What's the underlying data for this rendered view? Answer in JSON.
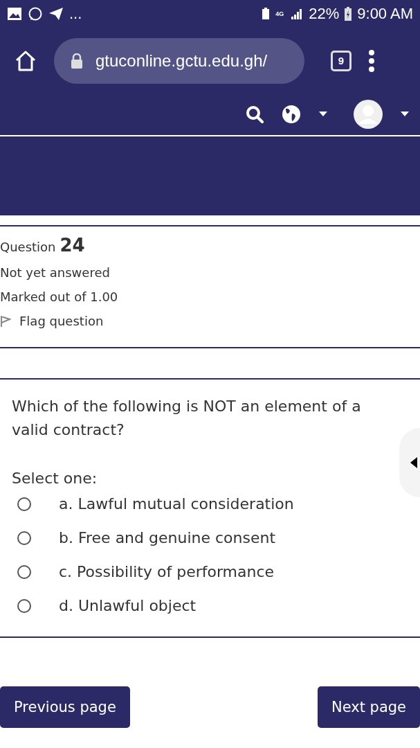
{
  "status_bar": {
    "more": "...",
    "network": "4G",
    "battery": "22%",
    "time": "9:00 AM"
  },
  "browser": {
    "url": "gtuconline.gctu.edu.gh/",
    "tabs_count": "9"
  },
  "question_info": {
    "label": "Question",
    "number": "24",
    "state": "Not yet answered",
    "marks": "Marked out of 1.00",
    "flag": "Flag question"
  },
  "question": {
    "text": "Which of the following is NOT an element of a valid contract?",
    "prompt": "Select one:",
    "options": [
      {
        "label": "a. Lawful mutual consideration",
        "selected": false
      },
      {
        "label": "b. Free and genuine consent",
        "selected": false
      },
      {
        "label": "c. Possibility of performance",
        "selected": false
      },
      {
        "label": "d. Unlawful object",
        "selected": false
      }
    ]
  },
  "nav": {
    "previous": "Previous page",
    "next": "Next page"
  }
}
